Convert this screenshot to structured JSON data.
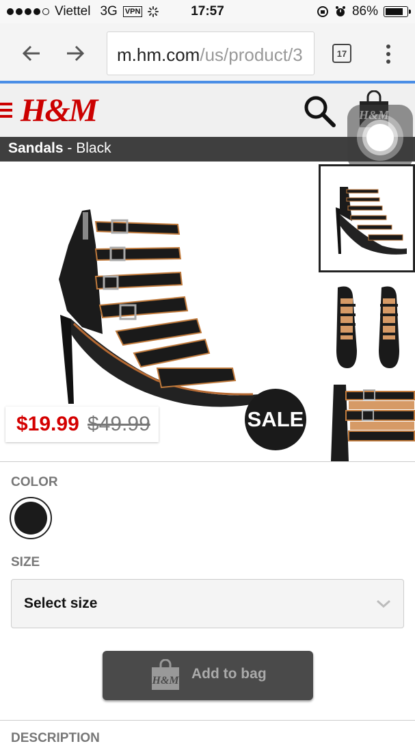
{
  "status_bar": {
    "carrier": "Viettel",
    "network": "3G",
    "vpn": "VPN",
    "time": "17:57",
    "battery": "86%",
    "battery_level": 0.86
  },
  "browser": {
    "url_host": "m.hm.com",
    "url_path": "/us/product/3",
    "tab_count": "17"
  },
  "header": {
    "logo": "H&M"
  },
  "product": {
    "name": "Sandals",
    "separator": " - ",
    "color_name": "Black",
    "price_sale": "$19.99",
    "price_original": "$49.99",
    "badge": "SALE"
  },
  "options": {
    "color_label": "COLOR",
    "size_label": "SIZE",
    "size_placeholder": "Select size",
    "add_to_bag": "Add to bag",
    "description_label": "DESCRIPTION"
  },
  "colors": {
    "brand_red": "#cc0000",
    "price_red": "#d40000",
    "title_bar": "#3f3f3f",
    "progress_blue": "#4a8ee6"
  },
  "icons": [
    "back-arrow-icon",
    "forward-arrow-icon",
    "tabs-icon",
    "overflow-menu-icon",
    "hamburger-icon",
    "search-icon",
    "shopping-bag-icon",
    "chevron-down-icon"
  ]
}
